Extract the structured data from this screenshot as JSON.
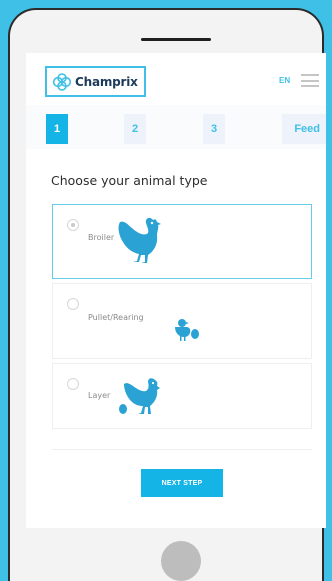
{
  "header": {
    "brand": "Champrix",
    "language": "EN"
  },
  "steps": [
    {
      "label": "1",
      "active": true
    },
    {
      "label": "2",
      "active": false
    },
    {
      "label": "3",
      "active": false
    },
    {
      "label": "Feed",
      "active": false
    }
  ],
  "page": {
    "title": "Choose your animal type"
  },
  "animal_options": [
    {
      "label": "Broiler",
      "selected": true,
      "icon": "chicken-icon"
    },
    {
      "label": "Pullet/Rearing",
      "selected": false,
      "icon": "chicks-icon"
    },
    {
      "label": "Layer",
      "selected": false,
      "icon": "hen-with-egg-icon"
    }
  ],
  "actions": {
    "next_label": "NEXT STEP"
  },
  "colors": {
    "accent": "#14b4e6",
    "background": "#3fc0e6",
    "brand_text": "#1b3a5a"
  }
}
